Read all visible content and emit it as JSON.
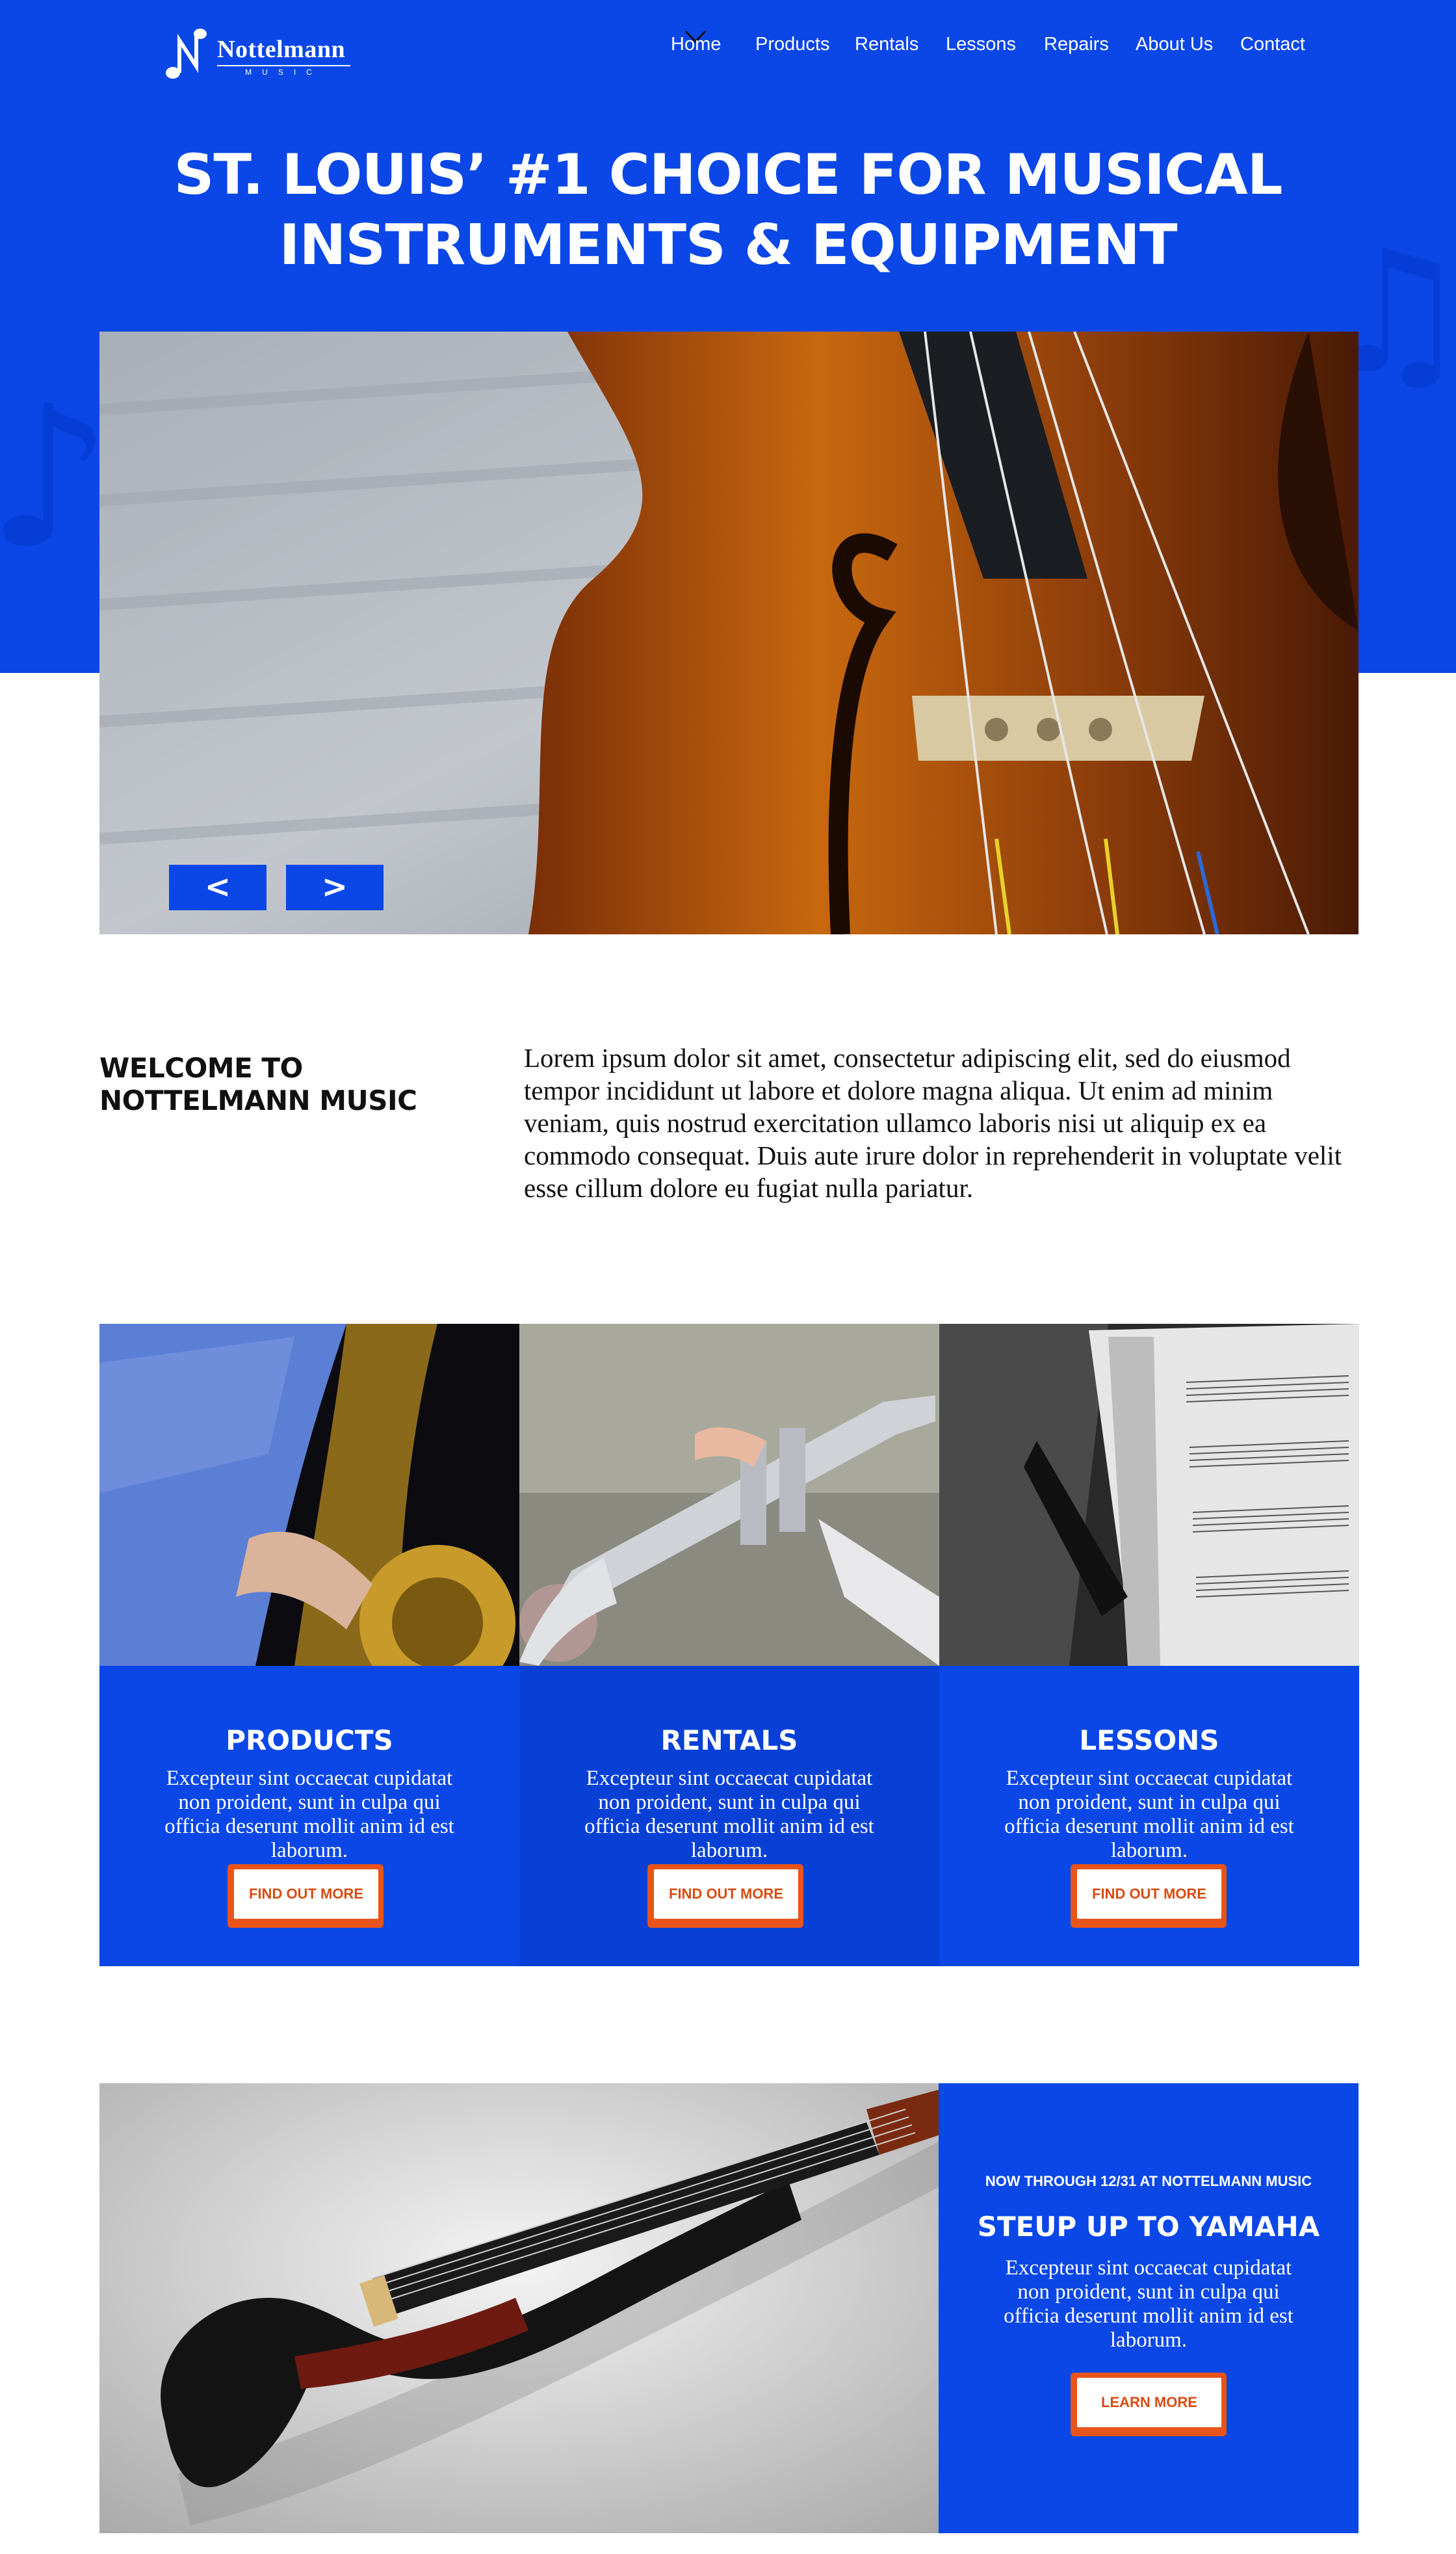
{
  "brand": {
    "name": "Nottelmann",
    "sub": "MUSIC"
  },
  "nav": {
    "items": [
      {
        "label": "Home"
      },
      {
        "label": "Products"
      },
      {
        "label": "Rentals"
      },
      {
        "label": "Lessons"
      },
      {
        "label": "Repairs"
      },
      {
        "label": "About Us"
      },
      {
        "label": "Contact"
      }
    ],
    "active": "Home"
  },
  "hero": {
    "title_line1": "ST. LOUIS’ #1 CHOICE FOR MUSICAL",
    "title_line2": "INSTRUMENTS & EQUIPMENT",
    "prev_label": "<",
    "next_label": ">"
  },
  "welcome": {
    "title_line1": "WELCOME TO",
    "title_line2": "NOTTELMANN MUSIC",
    "text": "Lorem ipsum dolor sit amet, consectetur adipiscing elit, sed do eiusmod tempor incididunt ut labore et dolore magna aliqua. Ut enim ad minim veniam, quis nostrud exercitation ullamco laboris nisi ut aliquip ex ea commodo consequat. Duis aute irure dolor in reprehenderit in voluptate velit esse cillum dolore eu fugiat nulla pariatur."
  },
  "cards": [
    {
      "title": "PRODUCTS",
      "text": "Excepteur sint occaecat cupidatat non proident, sunt in culpa qui officia deserunt mollit anim id est laborum.",
      "button": "FIND OUT MORE"
    },
    {
      "title": "RENTALS",
      "text": "Excepteur sint occaecat cupidatat non proident, sunt in culpa qui officia deserunt mollit anim id est laborum.",
      "button": "FIND OUT MORE"
    },
    {
      "title": "LESSONS",
      "text": "Excepteur sint occaecat cupidatat non proident, sunt in culpa qui officia deserunt mollit anim id est laborum.",
      "button": "FIND OUT MORE"
    }
  ],
  "promo": {
    "kicker": "NOW THROUGH 12/31 AT NOTTELMANN MUSIC",
    "title": "STEUP UP TO YAMAHA",
    "text": "Excepteur sint occaecat cupidatat non proident, sunt in culpa qui officia deserunt mollit anim id est laborum.",
    "button": "LEARN MORE"
  },
  "colors": {
    "brand_blue": "#0a47e6",
    "accent_orange": "#e8541a"
  }
}
